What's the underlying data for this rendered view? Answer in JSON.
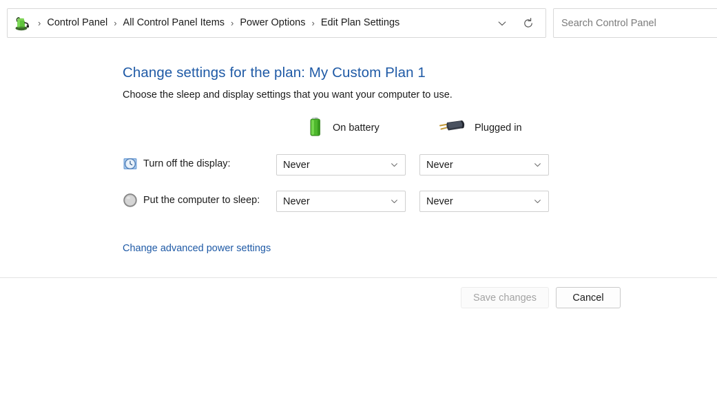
{
  "addressbar": {
    "app_icon": "control-panel-power-icon",
    "breadcrumbs": [
      {
        "label": "Control Panel"
      },
      {
        "label": "All Control Panel Items"
      },
      {
        "label": "Power Options"
      },
      {
        "label": "Edit Plan Settings"
      }
    ],
    "separator": "›",
    "history_icon": "chevron-down-icon",
    "refresh_icon": "refresh-icon"
  },
  "search": {
    "placeholder": "Search Control Panel",
    "value": ""
  },
  "page": {
    "title": "Change settings for the plan: My Custom Plan 1",
    "subtitle": "Choose the sleep and display settings that you want your computer to use.",
    "title_color": "#1f5aa6"
  },
  "columns": [
    {
      "key": "battery",
      "label": "On battery",
      "icon": "battery-icon"
    },
    {
      "key": "plugged",
      "label": "Plugged in",
      "icon": "power-plug-icon"
    }
  ],
  "settings_rows": [
    {
      "icon": "clock-icon",
      "label": "Turn off the display:",
      "battery_value": "Never",
      "plugged_value": "Never"
    },
    {
      "icon": "sleep-orb-icon",
      "label": "Put the computer to sleep:",
      "battery_value": "Never",
      "plugged_value": "Never"
    }
  ],
  "links": {
    "advanced_power_settings": "Change advanced power settings"
  },
  "footer": {
    "save_label": "Save changes",
    "save_enabled": false,
    "cancel_label": "Cancel"
  }
}
